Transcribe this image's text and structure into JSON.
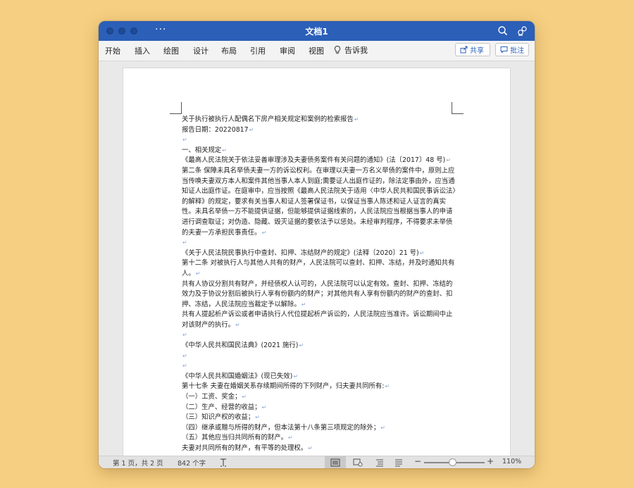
{
  "window": {
    "title": "文档1",
    "more_label": "···"
  },
  "ribbon": {
    "tabs": [
      "开始",
      "插入",
      "绘图",
      "设计",
      "布局",
      "引用",
      "审阅",
      "视图"
    ],
    "tell_me": "告诉我",
    "share_label": "共享",
    "comments_label": "批注"
  },
  "document": {
    "paragraphs": [
      "关于执行被执行人配偶名下房产相关规定和案例的检索报告",
      "报告日期：20220817",
      "",
      "一、相关规定",
      "《最高人民法院关于依法妥善审理涉及夫妻债务案件有关问题的通知》(法〔2017〕48 号)",
      "第二条 保障未具名举债夫妻一方的诉讼权利。在审理以夫妻一方名义举债的案件中，原则上应当传唤夫妻双方本人和案件其他当事人本人到庭;需要证人出庭作证的，除法定事由外，应当通知证人出庭作证。在庭审中，应当按照《最高人民法院关于适用〈中华人民共和国民事诉讼法〉的解释》的规定，要求有关当事人和证人签署保证书，以保证当事人陈述和证人证言的真实性。未具名举债一方不能提供证据，但能够提供证据线索的，人民法院应当根据当事人的申请进行调查取证；对伪造、隐藏、毁灭证据的要依法予以惩处。未经审判程序，不得要求未举债的夫妻一方承担民事责任。",
      "",
      "《关于人民法院民事执行中查封、扣押、冻结财产的规定》(法释〔2020〕21 号)",
      "第十二条 对被执行人与其他人共有的财产，人民法院可以查封、扣押、冻结，并及时通知共有人。",
      "共有人协议分割共有财产，并经债权人认可的，人民法院可以认定有效。查封、扣押、冻结的效力及于协议分割后被执行人享有份额内的财产；对其他共有人享有份额内的财产的查封、扣押、冻结，人民法院应当裁定予以解除。",
      "共有人提起析产诉讼或者申请执行人代位提起析产诉讼的，人民法院应当准许。诉讼期间中止对该财产的执行。",
      "",
      "《中华人民共和国民法典》(2021 施行)",
      "",
      "",
      "《中华人民共和国婚姻法》(现已失效)",
      "第十七条 夫妻在婚姻关系存续期间所得的下列财产，归夫妻共同所有:",
      "（一）工资、奖金；",
      "（二）生产、经营的收益；",
      "（三）知识产权的收益；",
      "（四）继承或赠与所得的财产，但本法第十八条第三项规定的除外；",
      "（五）其他应当归共同所有的财产。",
      "夫妻对共同所有的财产，有平等的处理权。"
    ]
  },
  "status": {
    "page": "第 1 页，共 2 页",
    "words": "842 个字",
    "zoom": "110%",
    "zoom_level_percent": 110
  }
}
